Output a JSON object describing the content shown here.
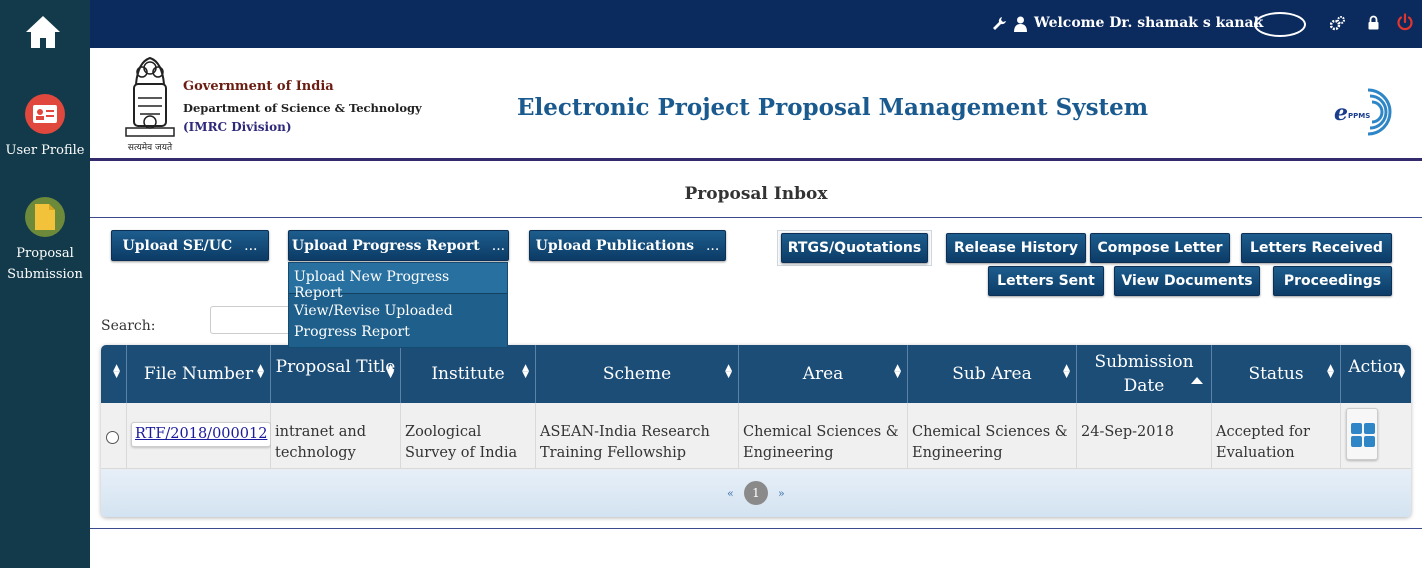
{
  "sidebar": {
    "items": [
      {
        "label": "User Profile",
        "icon": "id-card-icon",
        "color": "#e0483e"
      },
      {
        "label": "Proposal Submission",
        "icon": "document-icon",
        "color": "#c9a12f"
      }
    ]
  },
  "topbar": {
    "welcome": "Welcome Dr. shamak s kanak"
  },
  "header": {
    "gov_line1": "Government of India",
    "gov_line2": "Department of Science & Technology",
    "gov_line3": "(IMRC Division)",
    "emblem_caption": "सत्यमेव जयते",
    "app_title": "Electronic Project Proposal Management System",
    "logo_text": "PPMS"
  },
  "page_title": "Proposal Inbox",
  "buttons": {
    "upload_se_uc": "Upload SE/UC",
    "upload_progress": "Upload Progress Report",
    "upload_publications": "Upload Publications",
    "dots": "...",
    "rtgs": "RTGS/Quotations",
    "release_history": "Release History",
    "compose_letter": "Compose Letter",
    "letters_received": "Letters Received",
    "letters_sent": "Letters Sent",
    "view_documents": "View Documents",
    "proceedings": "Proceedings"
  },
  "dropdown": {
    "items": [
      "Upload New Progress Report",
      "View/Revise Uploaded Progress Report"
    ]
  },
  "search": {
    "label": "Search:",
    "value": ""
  },
  "table": {
    "columns": [
      "File Number",
      "Proposal Title",
      "Institute",
      "Scheme",
      "Area",
      "Sub Area",
      "Submission Date",
      "Status",
      "Action"
    ],
    "rows": [
      {
        "file_number": "RTF/2018/000012",
        "proposal_title": "intranet and technology",
        "institute": "Zoological Survey of India",
        "scheme": "ASEAN-India Research Training Fellowship",
        "area": "Chemical Sciences & Engineering",
        "sub_area": "Chemical Sciences & Engineering",
        "submission_date": "24-Sep-2018",
        "status": "Accepted for Evaluation"
      }
    ]
  },
  "pagination": {
    "prev": "«",
    "current": "1",
    "next": "»"
  },
  "colors": {
    "sidebar_bg": "#123a4a",
    "topbar_bg": "#0b2a5e",
    "table_header": "#1b4d77",
    "button": "#0c3b66"
  }
}
